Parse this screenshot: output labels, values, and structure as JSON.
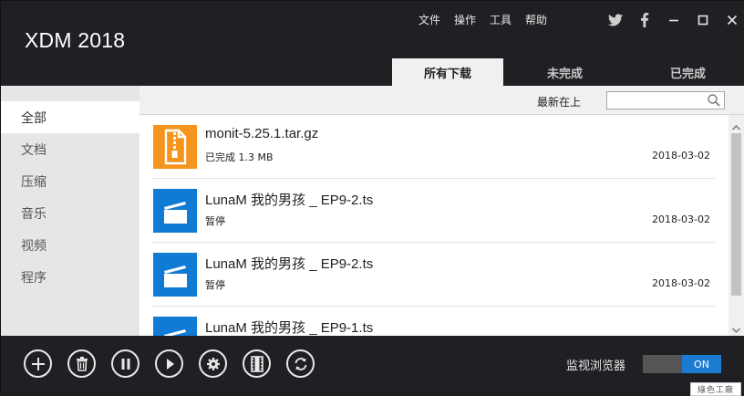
{
  "app": {
    "title": "XDM 2018"
  },
  "menu": [
    "文件",
    "操作",
    "工具",
    "帮助"
  ],
  "tabs": [
    {
      "label": "所有下载",
      "active": true
    },
    {
      "label": "未完成",
      "active": false
    },
    {
      "label": "已完成",
      "active": false
    }
  ],
  "sidebar": {
    "items": [
      {
        "label": "全部",
        "active": true
      },
      {
        "label": "文档",
        "active": false
      },
      {
        "label": "压缩",
        "active": false
      },
      {
        "label": "音乐",
        "active": false
      },
      {
        "label": "视频",
        "active": false
      },
      {
        "label": "程序",
        "active": false
      }
    ]
  },
  "sort": {
    "label": "最新在上",
    "search_placeholder": ""
  },
  "downloads": [
    {
      "name": "monit-5.25.1.tar.gz",
      "status": "已完成 1.3 MB",
      "date": "2018-03-02",
      "type": "archive"
    },
    {
      "name": "LunaM 我的男孩 _ EP9-2.ts",
      "status": "暂停",
      "date": "2018-03-02",
      "type": "video"
    },
    {
      "name": "LunaM 我的男孩 _ EP9-2.ts",
      "status": "暂停",
      "date": "2018-03-02",
      "type": "video"
    },
    {
      "name": "LunaM 我的男孩 _ EP9-1.ts",
      "status": "",
      "date": "",
      "type": "video"
    }
  ],
  "toolbar": {
    "buttons": [
      "add-icon",
      "trash-icon",
      "pause-icon",
      "play-icon",
      "settings-icon",
      "film-icon",
      "refresh-icon"
    ],
    "monitor_label": "监视浏览器",
    "toggle_state": "ON"
  },
  "watermark": "綠色工廠",
  "colors": {
    "accent": "#1b7bd1",
    "archive": "#f7941d",
    "video": "#0f7bd4",
    "chrome": "#1e2023"
  }
}
